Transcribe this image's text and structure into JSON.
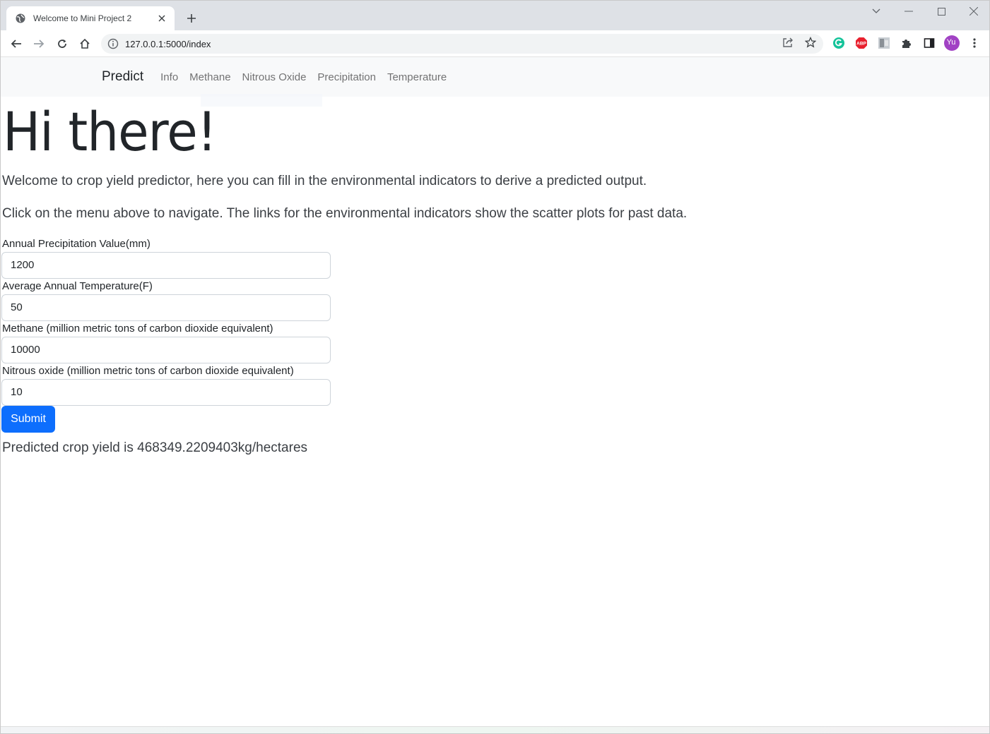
{
  "browser": {
    "tab_title": "Welcome to Mini Project 2",
    "url": "127.0.0.1:5000/index",
    "profile_initials": "Yu",
    "icons": [
      "globe-icon",
      "close-icon",
      "plus-icon",
      "back-icon",
      "forward-icon",
      "reload-icon",
      "home-icon",
      "info-icon",
      "share-icon",
      "star-icon",
      "grammarly-icon",
      "adblock-icon",
      "extension-photo-icon",
      "puzzle-icon",
      "sidepanel-icon",
      "kebab-menu-icon"
    ]
  },
  "nav": {
    "brand": "Predict",
    "links": [
      "Info",
      "Methane",
      "Nitrous Oxide",
      "Precipitation",
      "Temperature"
    ]
  },
  "main": {
    "heading": "Hi there!",
    "intro": "Welcome to crop yield predictor, here you can fill in the environmental indicators to derive a predicted output.",
    "instructions": "Click on the menu above to navigate. The links for the environmental indicators show the scatter plots for past data."
  },
  "form": {
    "fields": [
      {
        "label": "Annual Precipitation Value(mm)",
        "value": "1200"
      },
      {
        "label": "Average Annual Temperature(F)",
        "value": "50"
      },
      {
        "label": "Methane (million metric tons of carbon dioxide equivalent)",
        "value": "10000"
      },
      {
        "label": "Nitrous oxide (million metric tons of carbon dioxide equivalent)",
        "value": "10"
      }
    ],
    "submit_label": "Submit"
  },
  "result": "Predicted crop yield is 468349.2209403kg/hectares",
  "colors": {
    "primary_button": "#0d6efd",
    "navbar_bg": "#f8f9fa",
    "tabstrip_bg": "#dee1e6",
    "profile_avatar": "#a142c4"
  }
}
